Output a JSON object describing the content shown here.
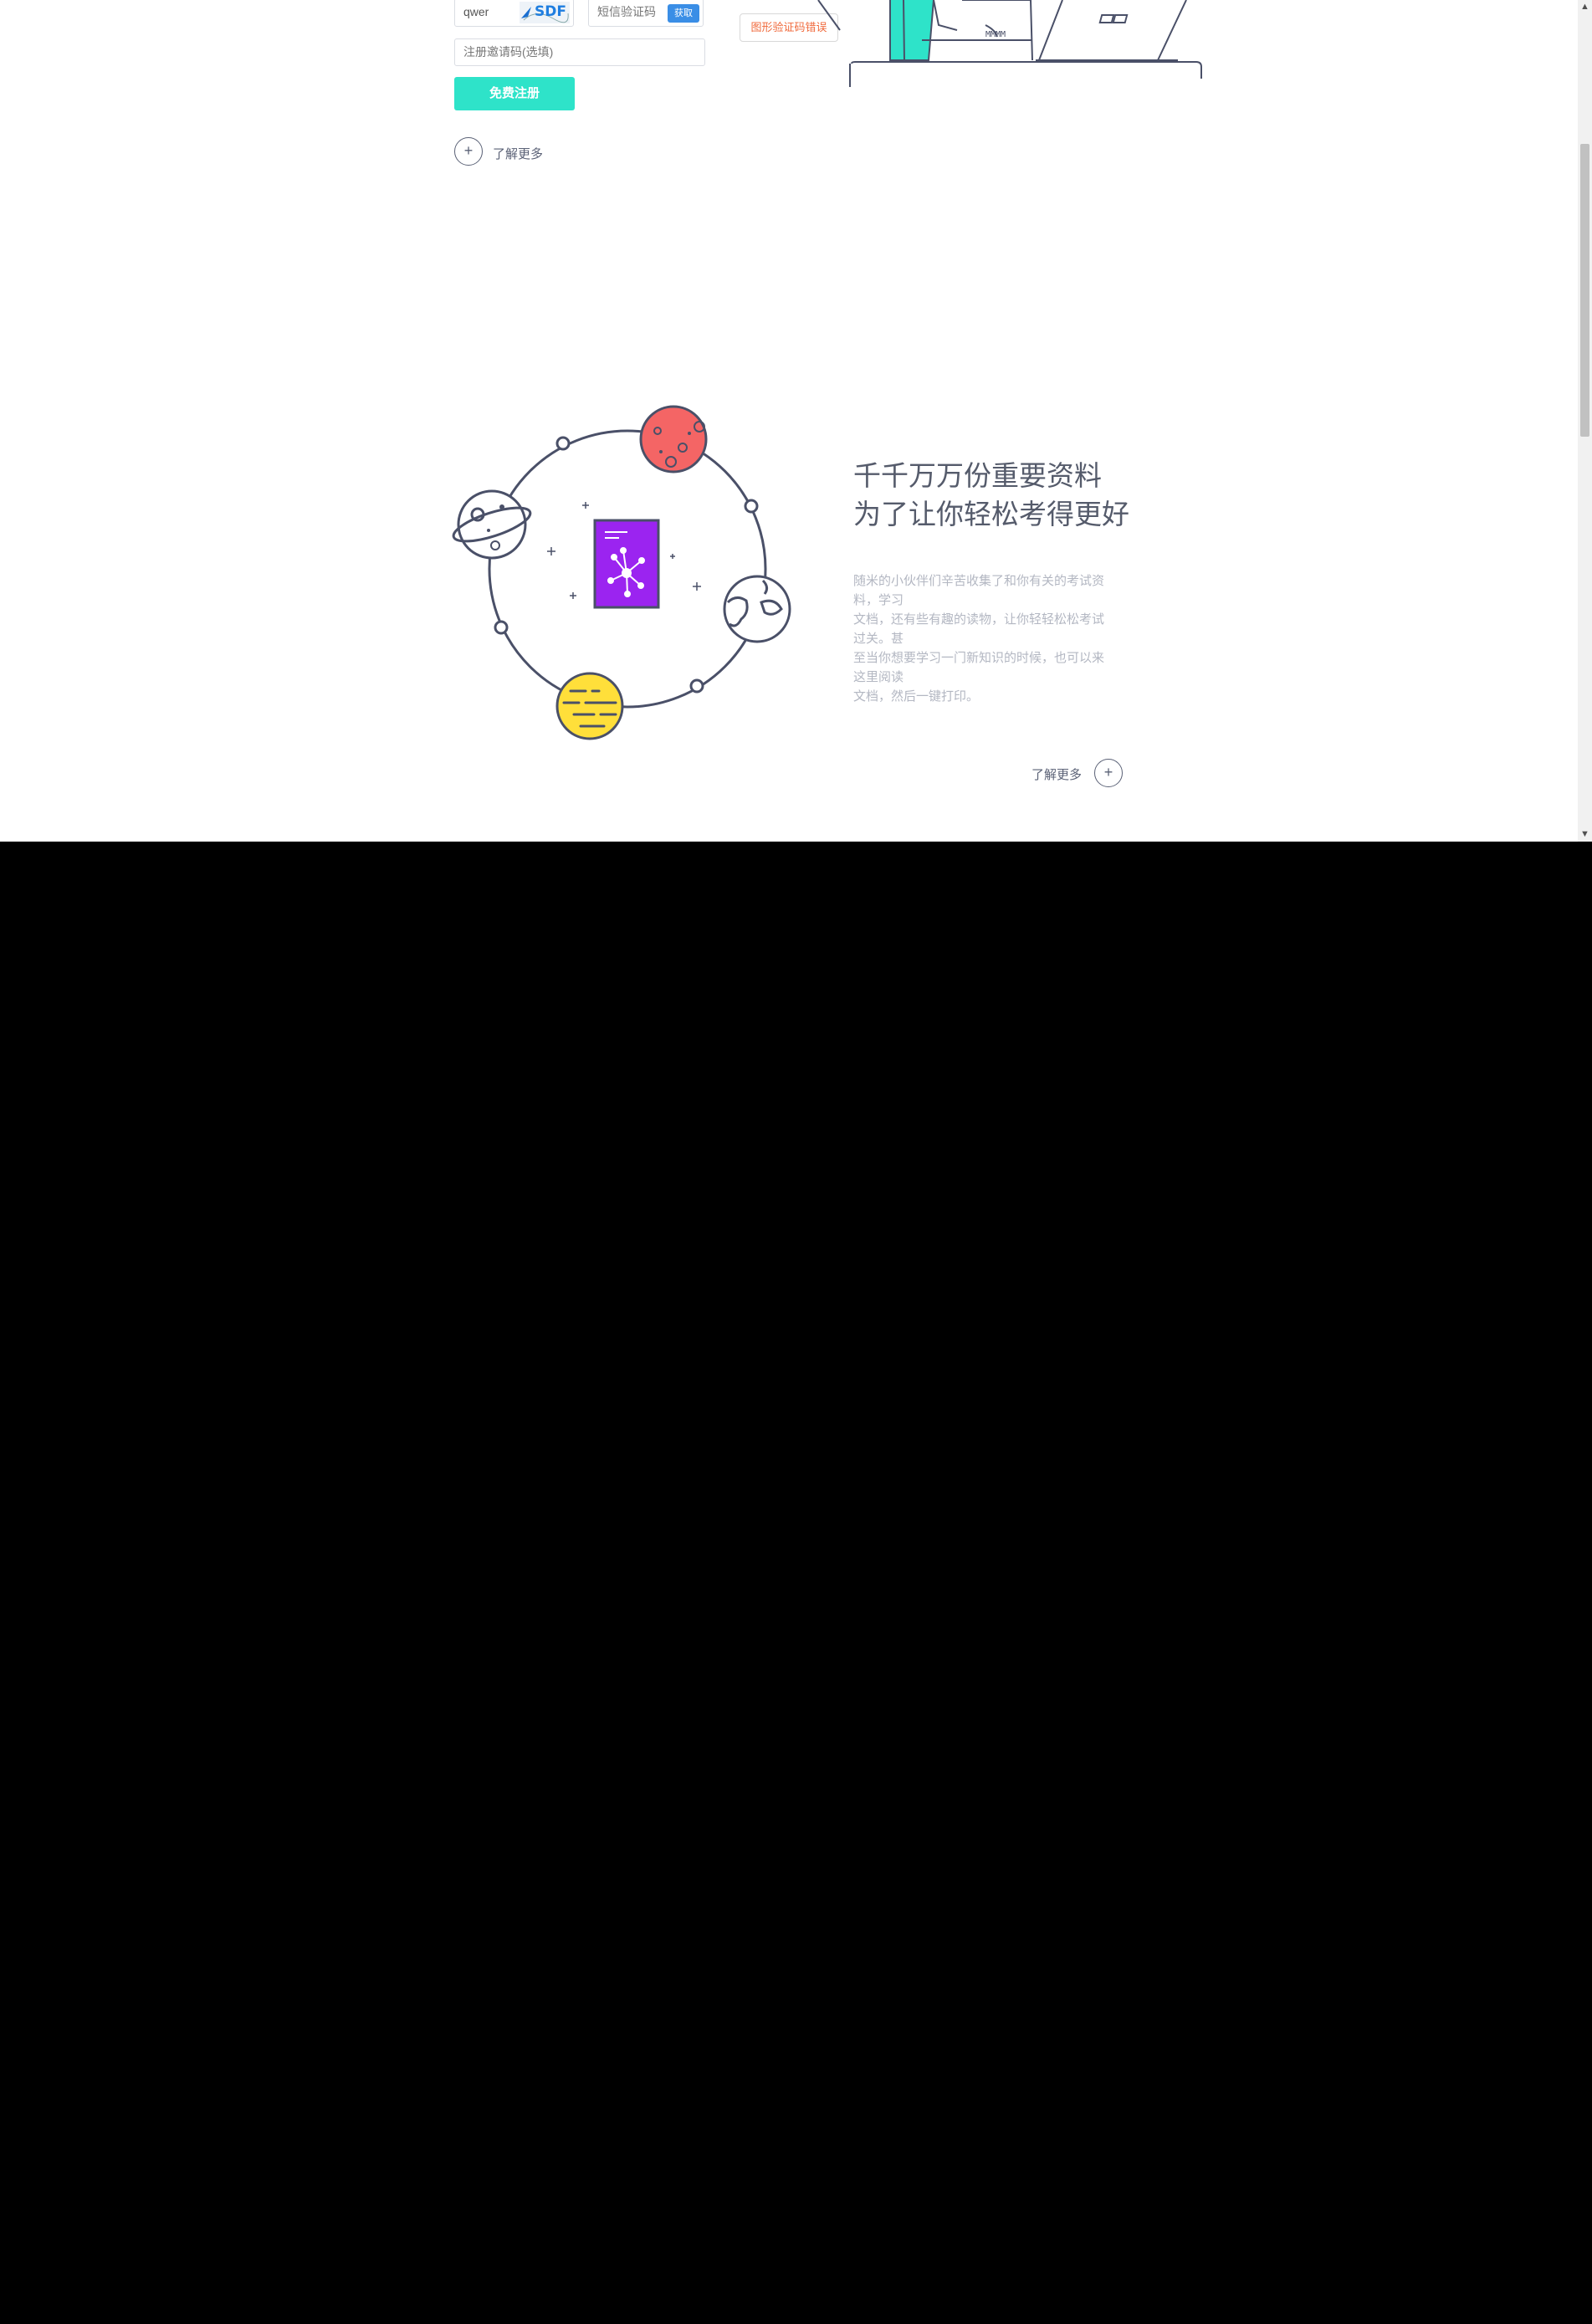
{
  "register_form": {
    "captcha_value": "qwer",
    "captcha_image_text": "SDF",
    "sms_placeholder": "短信验证码",
    "sms_button": "获取",
    "invite_placeholder": "注册邀请码(选填)",
    "submit_label": "免费注册",
    "error_tip": "图形验证码错误"
  },
  "top_section": {
    "learn_more": "了解更多"
  },
  "feature_section": {
    "headline": [
      "千千万万份重要资料",
      "为了让你轻松考得更好"
    ],
    "description": [
      "随米的小伙伴们辛苦收集了和你有关的考试资",
      "料，学习",
      "文档，还有些有趣的读物，让你轻轻松松考试",
      "过关。甚",
      "至当你想要学习一门新知识的时候，也可以来",
      "这里阅读",
      "文档，然后一键打印。"
    ],
    "learn_more": "了解更多"
  },
  "colors": {
    "accent_teal": "#2ee3c9",
    "button_blue": "#3a8ee6",
    "error_orange": "#f06a3c",
    "planet_red": "#f46565",
    "planet_yellow": "#ffdf3a",
    "book_purple": "#9b24f0",
    "line_navy": "#4a5068"
  },
  "icons": [
    "plus-circle-icon",
    "planet-illustration",
    "book-network-icon",
    "laptop-illustration"
  ]
}
